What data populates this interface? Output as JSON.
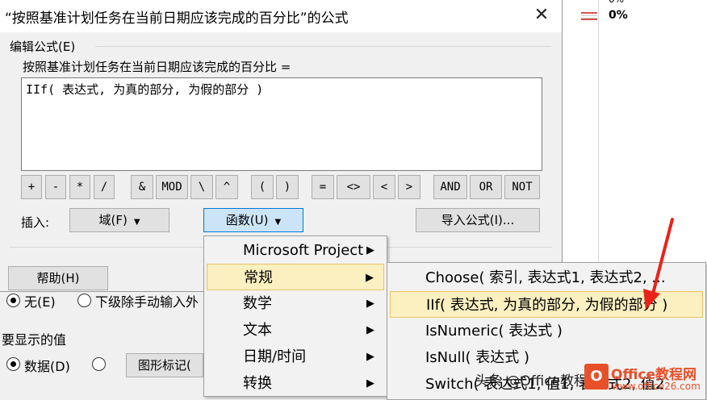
{
  "dialog": {
    "title": "“按照基准计划任务在当前日期应该完成的百分比”的公式",
    "close": "✕",
    "group_label": "编辑公式(E)",
    "expression_label": "按照基准计划任务在当前日期应该完成的百分比 =",
    "formula": "IIf( 表达式, 为真的部分, 为假的部分 )",
    "operators": [
      "+",
      "-",
      "*",
      "/",
      "&",
      "MOD",
      "\\",
      "^",
      "(",
      ")",
      "=",
      "<>",
      "<",
      ">",
      "AND",
      "OR",
      "NOT"
    ],
    "insert_label": "插入:",
    "field_button": "域(F)",
    "function_button": "函数(U)",
    "import_button": "导入公式(I)...",
    "help_button": "帮助(H)"
  },
  "background": {
    "percent": "0%",
    "percent_top": "0%",
    "radio_none_label": "无(E)",
    "radio_rollup_label": "下级除手动输入外",
    "section_label": "要显示的值",
    "radio_data_label": "数据(D)",
    "graphic_button": "图形标记("
  },
  "function_menu": {
    "items": [
      {
        "label": "Microsoft Project",
        "submenu": true
      },
      {
        "label": "常规",
        "submenu": true,
        "highlighted": true
      },
      {
        "label": "数学",
        "submenu": true
      },
      {
        "label": "文本",
        "submenu": true
      },
      {
        "label": "日期/时间",
        "submenu": true
      },
      {
        "label": "转换",
        "submenu": true
      }
    ]
  },
  "general_submenu": {
    "items": [
      {
        "label": "Choose( 索引, 表达式1, 表达式2, ..."
      },
      {
        "label": "IIf( 表达式, 为真的部分, 为假的部分 )",
        "highlighted": true
      },
      {
        "label": "IsNumeric( 表达式 )"
      },
      {
        "label": "IsNull( 表达式 )"
      },
      {
        "label": "Switch( 表达式1, 值1, 表达式2, 值2"
      }
    ]
  },
  "watermark": {
    "text": "头条 @Office教程网",
    "logo": "O",
    "brand": "Office教程网",
    "url": "www.office26.com"
  },
  "colors": {
    "accent_red": "#e8502a",
    "menu_highlight": "#fcefc0",
    "active_button": "#cce4f7"
  }
}
